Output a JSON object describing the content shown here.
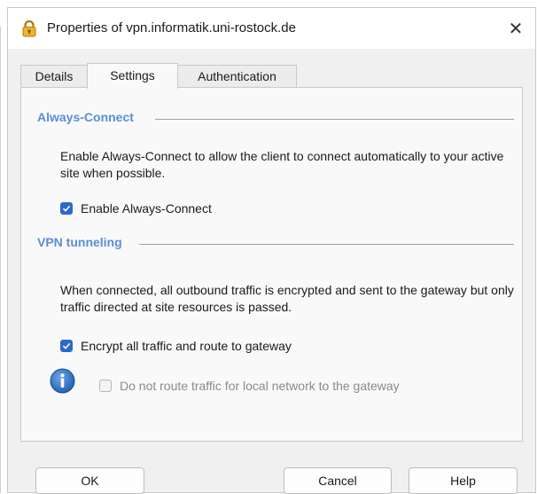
{
  "window": {
    "title": "Properties of vpn.informatik.uni-rostock.de",
    "close_glyph": "✕",
    "title_icon": "lock-icon"
  },
  "tabs": [
    {
      "label": "Details",
      "active": false
    },
    {
      "label": "Settings",
      "active": true
    },
    {
      "label": "Authentication",
      "active": false
    }
  ],
  "always_connect": {
    "title": "Always-Connect",
    "description": "Enable Always-Connect to allow the client to connect automatically to your active site when possible.",
    "checkbox_label": "Enable Always-Connect",
    "checked": true
  },
  "vpn_tunneling": {
    "title": "VPN tunneling",
    "description": "When connected, all outbound traffic is encrypted and sent to the gateway but only traffic directed at site resources is passed.",
    "encrypt_label": "Encrypt all traffic and route to gateway",
    "encrypt_checked": true,
    "local_label": "Do not route traffic for local network to the gateway",
    "local_checked": false,
    "local_disabled": true,
    "info_icon": "info-icon"
  },
  "buttons": {
    "ok": "OK",
    "cancel": "Cancel",
    "help": "Help"
  },
  "colors": {
    "accent": "#2c6ac8",
    "section_title": "#5b8ed6",
    "lock_gold": "#e8a317"
  }
}
